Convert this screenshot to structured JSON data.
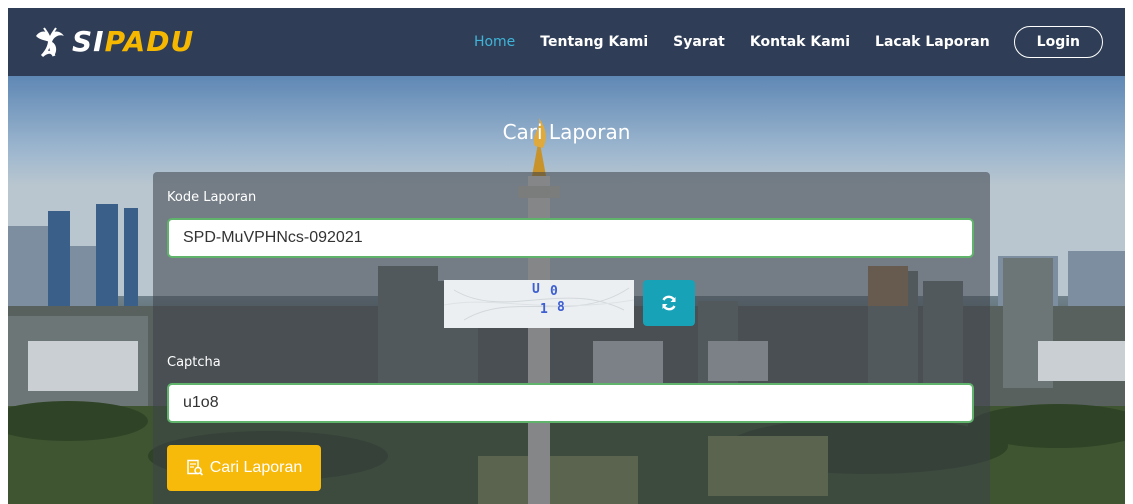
{
  "brand": {
    "logo_text_white": "SI",
    "logo_text_yellow": "PADU"
  },
  "nav": {
    "items": [
      "Home",
      "Tentang Kami",
      "Syarat",
      "Kontak Kami",
      "Lacak Laporan"
    ],
    "active": "Home",
    "login_label": "Login"
  },
  "hero": {
    "title": "Cari Laporan"
  },
  "form": {
    "kode_label": "Kode Laporan",
    "kode_value": "SPD-MuVPHNcs-092021",
    "captcha_chars": [
      "U",
      "0",
      "1",
      "8"
    ],
    "captcha_label": "Captcha",
    "captcha_value": "u1o8",
    "submit_label": "Cari Laporan"
  },
  "colors": {
    "navbar": "#2f3e56",
    "nav_active": "#3fb4d8",
    "brand_yellow": "#f5b700",
    "refresh_button": "#17a2b8",
    "submit_button": "#f7b90a",
    "input_border": "#5fb36a"
  },
  "icons": {
    "refresh": "refresh-icon",
    "search_doc": "search-document-icon"
  }
}
